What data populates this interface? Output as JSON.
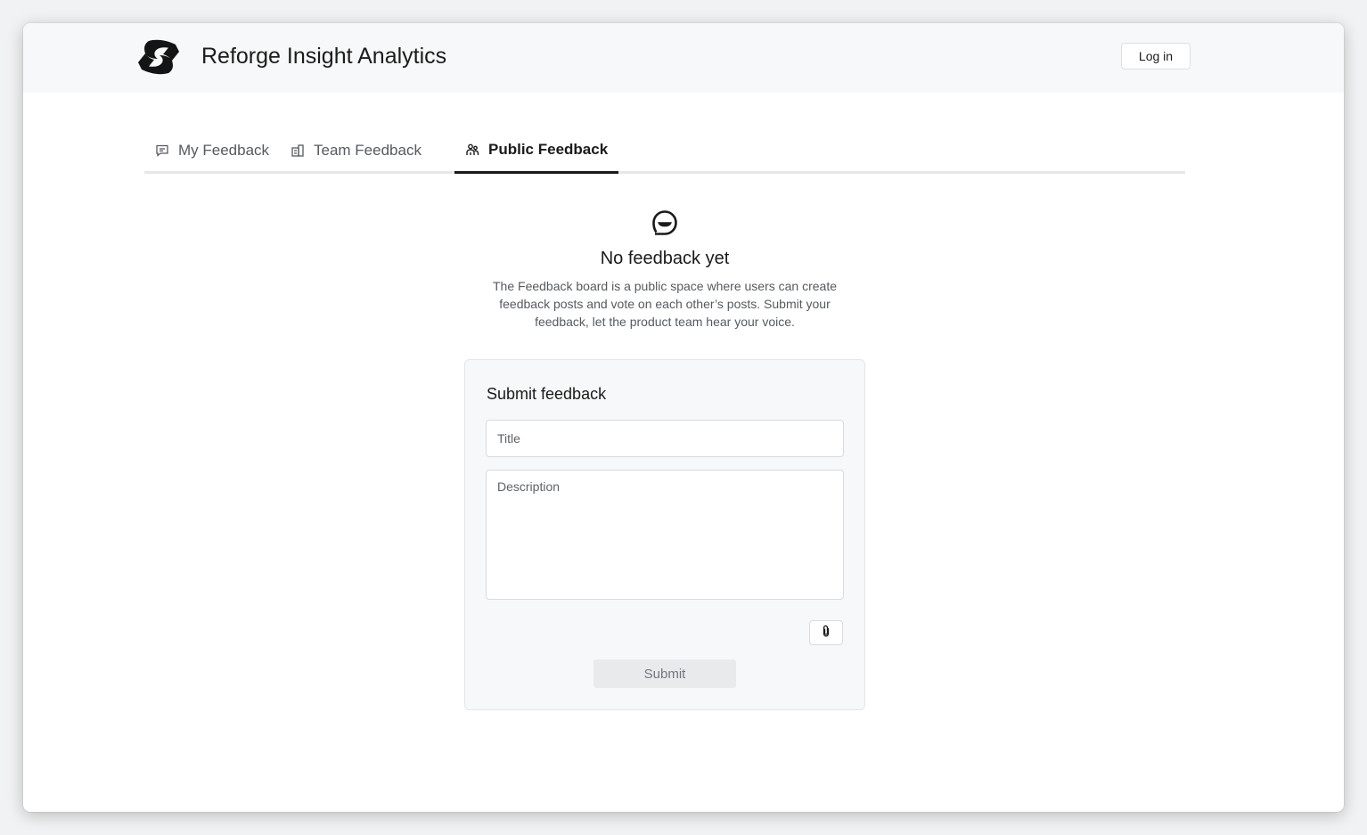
{
  "header": {
    "app_title": "Reforge Insight Analytics",
    "login_label": "Log in",
    "logo_icon": "reforge-logo-icon"
  },
  "tabs": [
    {
      "label": "My Feedback",
      "icon": "message-square-icon",
      "active": false
    },
    {
      "label": "Team Feedback",
      "icon": "building-icon",
      "active": false
    },
    {
      "label": "Public Feedback",
      "icon": "people-icon",
      "active": true
    }
  ],
  "empty_state": {
    "icon": "chat-smile-icon",
    "title": "No feedback yet",
    "description": "The Feedback board is a public space where users can create feedback posts and vote on each other’s posts. Submit your feedback, let the product team hear your voice."
  },
  "form": {
    "heading": "Submit feedback",
    "title_placeholder": "Title",
    "title_value": "",
    "description_placeholder": "Description",
    "description_value": "",
    "attach_icon": "paperclip-icon",
    "submit_label": "Submit"
  },
  "colors": {
    "accent": "#1a1a1a",
    "header_bg": "#f7f8f9",
    "submit_disabled_bg": "#e9eaec"
  }
}
